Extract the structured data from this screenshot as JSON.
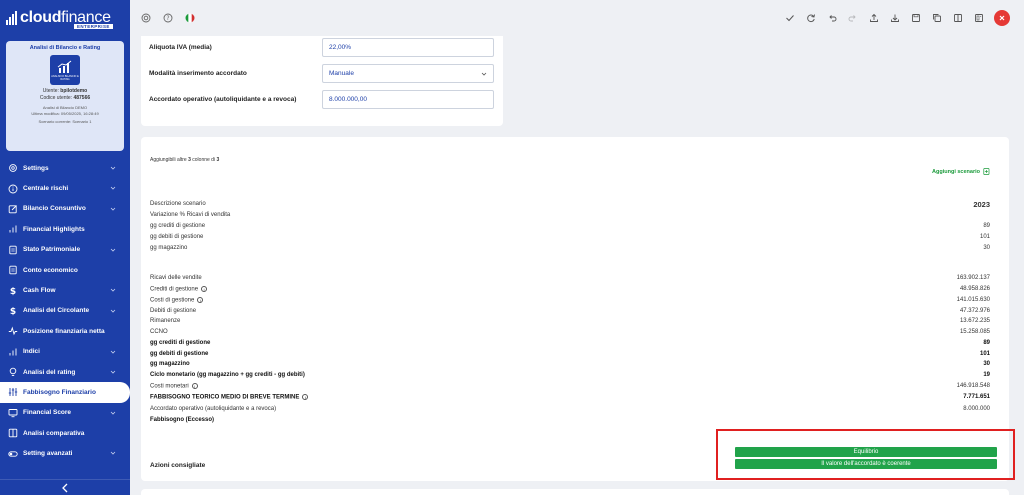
{
  "app": {
    "logo_main": "cloud",
    "logo_thin": "finance",
    "logo_sub": "ENTERPRISE"
  },
  "card": {
    "title": "Analisi di Bilancio e Rating",
    "icon_label": "ANALISI DI BILANCIO E RATING",
    "user_label": "Utente:",
    "user_value": "bpilotdemo",
    "code_label": "Codice utente:",
    "code_value": "487566",
    "analysis": "Analisi di Bilancio DEMO",
    "last_mod": "Ultima modifica: 09/05/2025, 16:28:49",
    "scenario": "Scenario corrente: Scenario 1"
  },
  "menu": [
    {
      "label": "Settings",
      "icon": "gear-icon",
      "chevron": true
    },
    {
      "label": "Centrale rischi",
      "icon": "info-circle-icon",
      "chevron": true
    },
    {
      "label": "Bilancio Consuntivo",
      "icon": "edit-icon",
      "chevron": true
    },
    {
      "label": "Financial Highlights",
      "icon": "bar-chart-icon",
      "chevron": false
    },
    {
      "label": "Stato Patrimoniale",
      "icon": "document-icon",
      "chevron": true
    },
    {
      "label": "Conto economico",
      "icon": "document-icon",
      "chevron": false
    },
    {
      "label": "Cash Flow",
      "icon": "dollar-icon",
      "chevron": true
    },
    {
      "label": "Analisi del Circolante",
      "icon": "dollar-icon",
      "chevron": true
    },
    {
      "label": "Posizione finanziaria netta",
      "icon": "activity-icon",
      "chevron": false
    },
    {
      "label": "Indici",
      "icon": "bar-chart-icon",
      "chevron": true
    },
    {
      "label": "Analisi del rating",
      "icon": "lightbulb-icon",
      "chevron": true
    },
    {
      "label": "Fabbisogno Finanziario",
      "icon": "sliders-icon",
      "chevron": false,
      "active": true
    },
    {
      "label": "Financial Score",
      "icon": "monitor-icon",
      "chevron": true
    },
    {
      "label": "Analisi comparativa",
      "icon": "columns-icon",
      "chevron": false
    },
    {
      "label": "Setting avanzati",
      "icon": "toggle-icon",
      "chevron": true
    }
  ],
  "form": {
    "iva_label": "Aliquota IVA (media)",
    "iva_value": "22,00%",
    "mode_label": "Modalità inserimento accordato",
    "mode_value": "Manuale",
    "accordato_label": "Accordato operativo (autoliquidante e a revoca)",
    "accordato_value": "8.000.000,00"
  },
  "table": {
    "note_prefix": "Aggiungibili altre",
    "note_count": "3",
    "note_mid": "colonne di",
    "note_total": "3",
    "add_scenario": "Aggiungi scenario",
    "rows": [
      {
        "label": "Descrizione scenario",
        "value": "2023"
      },
      {
        "label": "Variazione % Ricavi di vendita",
        "value": ""
      },
      {
        "label": "gg crediti di gestione",
        "value": "89"
      },
      {
        "label": "gg debiti di gestione",
        "value": "101"
      },
      {
        "label": "gg magazzino",
        "value": "30"
      },
      {
        "label": "Ricavi delle vendite",
        "value": "163.902.137"
      },
      {
        "label": "Crediti di gestione",
        "value": "48.958.826"
      },
      {
        "label": "Costi di gestione",
        "value": "141.015.630"
      },
      {
        "label": "Debiti di gestione",
        "value": "47.372.976"
      },
      {
        "label": "Rimanenze",
        "value": "13.672.235"
      },
      {
        "label": "CCNO",
        "value": "15.258.085"
      },
      {
        "label": "gg crediti di gestione",
        "value": "89"
      },
      {
        "label": "gg debiti di gestione",
        "value": "101"
      },
      {
        "label": "gg magazzino",
        "value": "30"
      },
      {
        "label": "Ciclo monetario (gg magazzino + gg crediti - gg debiti)",
        "value": "19"
      },
      {
        "label": "Costi monetari",
        "value": "146.918.548"
      },
      {
        "label": "FABBISOGNO TEORICO MEDIO DI BREVE TERMINE",
        "value": "7.771.651"
      },
      {
        "label": "Accordato operativo (autoliquidante e a revoca)",
        "value": "8.000.000"
      },
      {
        "label": "Fabbisogno (Eccesso)",
        "value": ""
      }
    ],
    "azioni_label": "Azioni consigliate",
    "badge1": "Equilibrio",
    "badge2": "Il valore dell'accordato è coerente"
  },
  "colors": {
    "sidebar": "#1d3fa8",
    "accent_green": "#21a34a",
    "highlight_red": "#e02020"
  }
}
